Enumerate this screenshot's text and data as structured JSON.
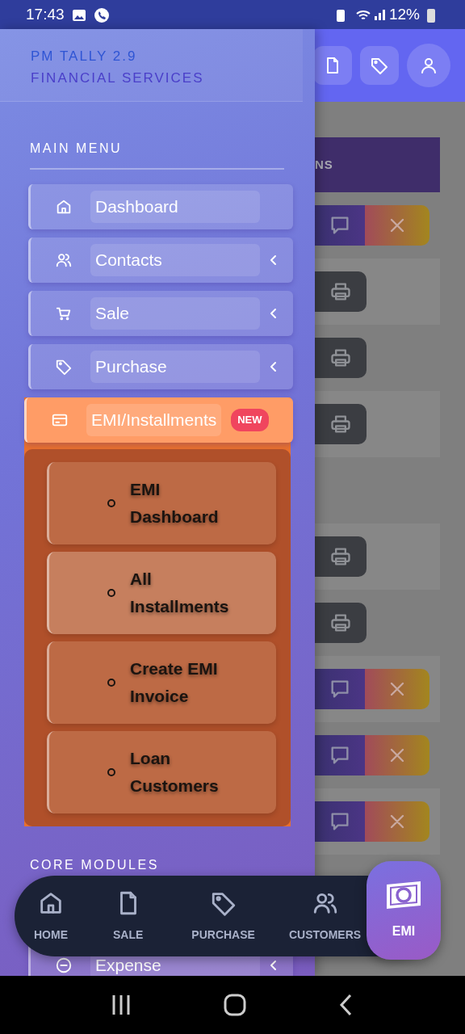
{
  "status_bar": {
    "time": "17:43",
    "battery": "12%"
  },
  "drawer": {
    "brand": {
      "line1": "PM TALLY 2.9",
      "line2": "FINANCIAL SERVICES"
    },
    "sections": [
      {
        "title": "MAIN MENU",
        "items": [
          {
            "label": "Dashboard",
            "submenu": false,
            "expanded": false
          },
          {
            "label": "Contacts",
            "submenu": true,
            "expanded": false
          },
          {
            "label": "Sale",
            "submenu": true,
            "expanded": false
          },
          {
            "label": "Purchase",
            "submenu": true,
            "expanded": false
          },
          {
            "label": "EMI/Installments",
            "expanded": true,
            "badge": "NEW",
            "children": [
              {
                "label": "EMI Dashboard",
                "selected": false
              },
              {
                "label": "All Installments",
                "selected": true
              },
              {
                "label": "Create EMI Invoice",
                "selected": false
              },
              {
                "label": "Loan Customers",
                "selected": false
              }
            ]
          }
        ]
      },
      {
        "title": "CORE MODULES",
        "items": [
          {
            "label": "Expense",
            "submenu": true,
            "expanded": false
          }
        ]
      }
    ]
  },
  "background_page": {
    "table": {
      "column_header": "NS"
    },
    "rows": [
      {
        "kind": "message-cancel"
      },
      {
        "kind": "print"
      },
      {
        "kind": "print"
      },
      {
        "kind": "print"
      },
      {
        "kind": "empty"
      },
      {
        "kind": "print"
      },
      {
        "kind": "print"
      },
      {
        "kind": "message-cancel"
      },
      {
        "kind": "message-cancel"
      },
      {
        "kind": "message-cancel"
      }
    ]
  },
  "bottom_nav": {
    "items": [
      {
        "label": "HOME"
      },
      {
        "label": "SALE"
      },
      {
        "label": "PURCHASE"
      },
      {
        "label": "CUSTOMERS"
      }
    ],
    "emi_button": {
      "label": "EMI"
    }
  }
}
